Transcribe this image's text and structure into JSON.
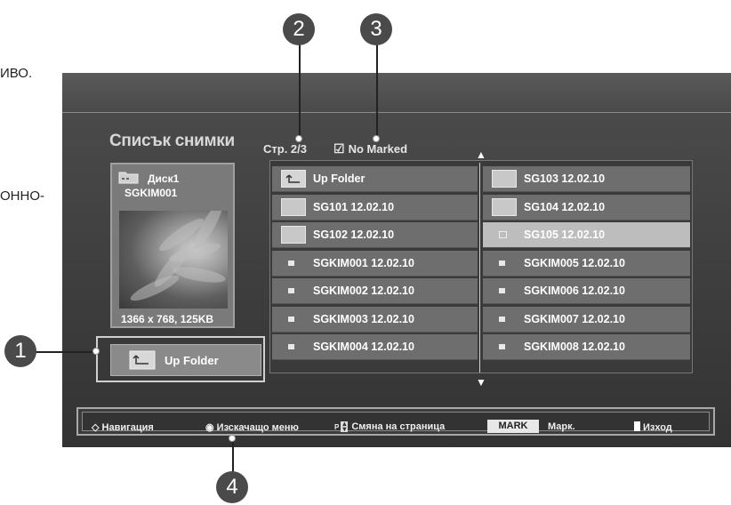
{
  "side_text": [
    "ИВО.",
    "ОННО-"
  ],
  "screen": {
    "title": "Списък снимки",
    "page_info": "Стр. 2/3",
    "marked_check": "☑",
    "marked_label": "No Marked",
    "scroll_up": "▲",
    "scroll_down": "▼"
  },
  "preview": {
    "folder_icon": "folder-open-icon",
    "disk": "Диск1",
    "file": "SGKIM001",
    "resolution": "1366 x 768, 125KB"
  },
  "up_folder_button": "Up Folder",
  "list": {
    "left": [
      {
        "icon": "up-folder-icon",
        "label": "Up Folder"
      },
      {
        "icon": "folder-icon",
        "label": "SG101 12.02.10"
      },
      {
        "icon": "folder-icon",
        "label": "SG102 12.02.10"
      },
      {
        "icon": "photo-file-icon",
        "label": "SGKIM001 12.02.10"
      },
      {
        "icon": "photo-file-icon",
        "label": "SGKIM002 12.02.10"
      },
      {
        "icon": "photo-file-icon",
        "label": "SGKIM003 12.02.10"
      },
      {
        "icon": "photo-file-icon",
        "label": "SGKIM004 12.02.10"
      }
    ],
    "right": [
      {
        "icon": "folder-icon",
        "label": "SG103 12.02.10"
      },
      {
        "icon": "folder-icon",
        "label": "SG104 12.02.10"
      },
      {
        "icon": "photo-file-icon",
        "label": "SG105 12.02.10",
        "selected": true
      },
      {
        "icon": "photo-file-icon",
        "label": "SGKIM005 12.02.10"
      },
      {
        "icon": "photo-file-icon",
        "label": "SGKIM006 12.02.10"
      },
      {
        "icon": "photo-file-icon",
        "label": "SGKIM007 12.02.10"
      },
      {
        "icon": "photo-file-icon",
        "label": "SGKIM008 12.02.10"
      }
    ]
  },
  "help": {
    "nav_glyph": "◇",
    "nav": "Навигация",
    "popup_glyph": "◉",
    "popup": "Изскачащо меню",
    "page_glyph": "P",
    "page": "Смяна на страница",
    "mark_key": "MARK",
    "mark": "Марк.",
    "exit": "Изход"
  },
  "callouts": [
    "1",
    "2",
    "3",
    "4"
  ]
}
